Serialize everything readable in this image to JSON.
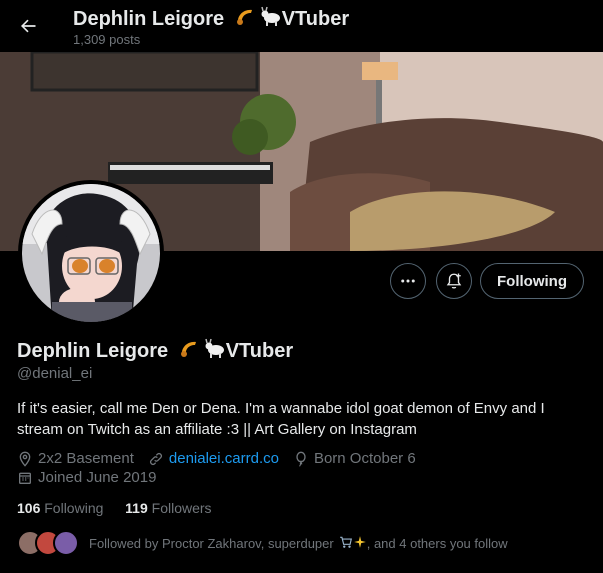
{
  "header": {
    "name": "Dephlin Leigore",
    "name_suffix": "VTuber",
    "posts": "1,309 posts"
  },
  "actions": {
    "follow_label": "Following"
  },
  "profile": {
    "name": "Dephlin Leigore",
    "name_suffix": "VTuber",
    "handle": "@denial_ei",
    "bio": "If it's easier, call me Den or Dena. I'm a wannabe idol goat demon of Envy and I stream on Twitch as an affiliate :3 || Art Gallery on Instagram",
    "location": "2x2 Basement",
    "website": "denialei.carrd.co",
    "born": "Born October 6",
    "joined": "Joined June 2019"
  },
  "stats": {
    "following_count": "106",
    "following_label": "Following",
    "followers_count": "119",
    "followers_label": "Followers"
  },
  "followed_by": {
    "text_prefix": "Followed by Proctor Zakharov, superduper",
    "text_suffix": ", and 4 others you follow"
  },
  "colors": {
    "background": "#000000",
    "text": "#e7e9ea",
    "muted": "#71767b",
    "link": "#1d9bf0",
    "border": "#536471"
  }
}
